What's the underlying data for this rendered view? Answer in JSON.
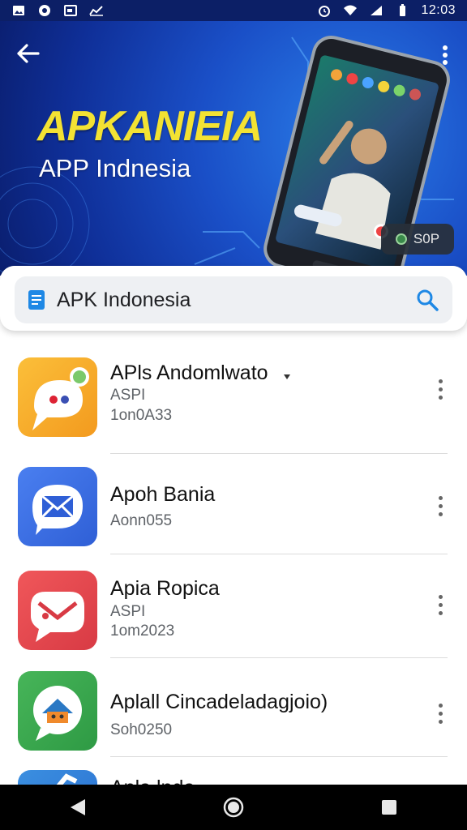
{
  "status_bar": {
    "time": "12:03",
    "left_icons": [
      "image-icon",
      "circle-app-icon",
      "gallery-icon",
      "chart-icon"
    ],
    "right_icons": [
      "alarm-icon",
      "wifi-icon",
      "signal-icon",
      "battery-icon"
    ]
  },
  "hero": {
    "title": "APKANIEIA",
    "subtitle": "APP Indnesia",
    "badge_label": "S0P",
    "colors": {
      "title": "#f3e233",
      "background": "#1a4fc7"
    }
  },
  "search": {
    "value": "APK Indonesia",
    "leading_icon": "document-icon",
    "trailing_icon": "search-icon"
  },
  "apps": [
    {
      "name": "APls Andomlwato",
      "line1": "ASPI",
      "line2": "1on0A33",
      "icon": "chat-bubble-icon",
      "color": "#f5a623"
    },
    {
      "name": "Apoh Bania",
      "line1": "Aonn055",
      "line2": "",
      "icon": "mail-envelope-icon",
      "color": "#3b6fe0"
    },
    {
      "name": "Apia Ropica",
      "line1": "ASPI",
      "line2": "1om2023",
      "icon": "mail-envelope-icon",
      "color": "#e24a4a"
    },
    {
      "name": "Aplall Cincadeladagjoio)",
      "line1": "Soh0250",
      "line2": "",
      "icon": "chat-house-icon",
      "color": "#3da34b"
    },
    {
      "name": "Apla lnda",
      "line1": "",
      "line2": "",
      "icon": "check-icon",
      "color": "#3b8fe0"
    }
  ],
  "nav": [
    "back-icon",
    "home-icon",
    "recents-icon"
  ]
}
